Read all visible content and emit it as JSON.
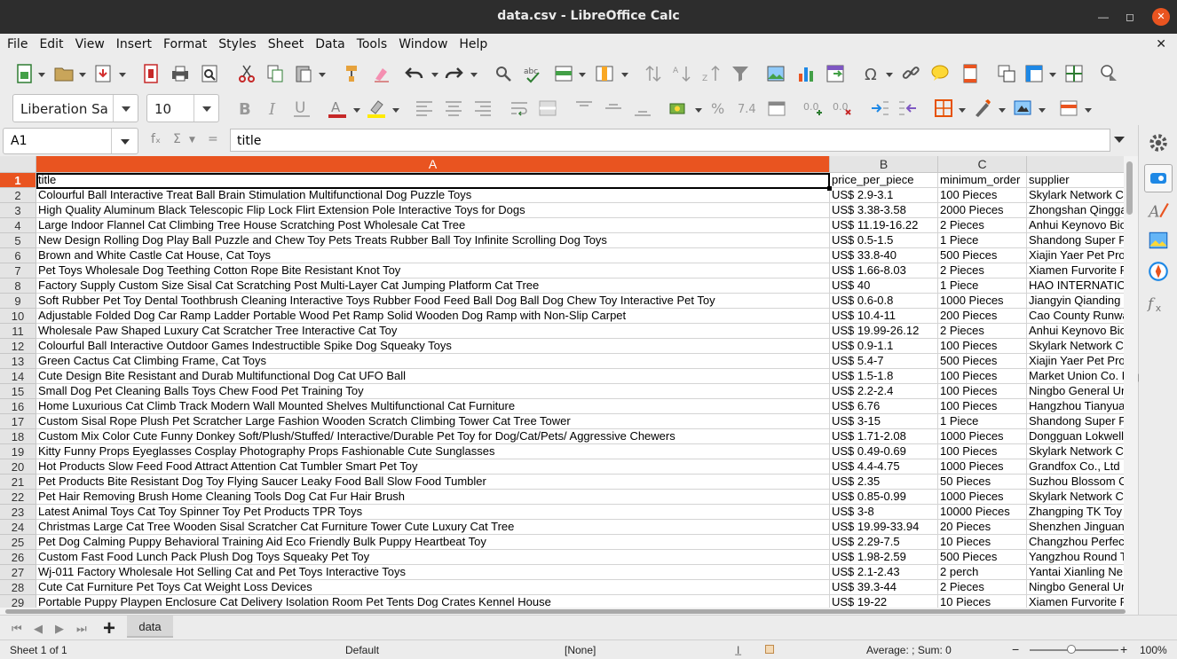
{
  "window": {
    "title": "data.csv - LibreOffice Calc"
  },
  "menu": [
    "File",
    "Edit",
    "View",
    "Insert",
    "Format",
    "Styles",
    "Sheet",
    "Data",
    "Tools",
    "Window",
    "Help"
  ],
  "formatting": {
    "font_name": "Liberation Sa",
    "font_size": "10"
  },
  "formula_bar": {
    "cell_ref": "A1",
    "content": "title"
  },
  "columns": [
    {
      "letter": "A",
      "selected": true
    },
    {
      "letter": "B",
      "selected": false
    },
    {
      "letter": "C",
      "selected": false
    },
    {
      "letter": "",
      "selected": false
    }
  ],
  "rows": [
    {
      "n": "1",
      "cells": [
        "title",
        "price_per_piece",
        "minimum_order",
        "supplier"
      ]
    },
    {
      "n": "2",
      "cells": [
        "Colourful Ball Interactive Treat Ball Brain Stimulation Multifunctional Dog Puzzle Toys",
        "US$ 2.9-3.1",
        "100 Pieces",
        "Skylark Network C"
      ]
    },
    {
      "n": "3",
      "cells": [
        "High Quality Aluminum Black Telescopic Flip Lock Flirt Extension Pole Interactive Toys for Dogs",
        "US$ 3.38-3.58",
        "2000 Pieces",
        "Zhongshan Qingga"
      ]
    },
    {
      "n": "4",
      "cells": [
        "Large Indoor Flannel Cat Climbing Tree House Scratching Post Wholesale Cat Tree",
        "US$ 11.19-16.22",
        "2 Pieces",
        "Anhui Keynovo Bio"
      ]
    },
    {
      "n": "5",
      "cells": [
        "New Design Rolling Dog Play Ball Puzzle and Chew Toy Pets Treats Rubber Ball Toy Infinite Scrolling Dog Toys",
        "US$ 0.5-1.5",
        "1 Piece",
        "Shandong Super P"
      ]
    },
    {
      "n": "6",
      "cells": [
        "Brown and White Castle Cat House, Cat Toys",
        "US$ 33.8-40",
        "500 Pieces",
        "Xiajin Yaer Pet Pro"
      ]
    },
    {
      "n": "7",
      "cells": [
        "Pet Toys Wholesale Dog Teething Cotton Rope Bite Resistant Knot Toy",
        "US$ 1.66-8.03",
        "2 Pieces",
        "Xiamen Furvorite F"
      ]
    },
    {
      "n": "8",
      "cells": [
        "Factory Supply Custom Size Sisal Cat Scratching Post Multi-Layer Cat Jumping Platform Cat Tree",
        "US$ 40",
        "1 Piece",
        "HAO INTERNATIO"
      ]
    },
    {
      "n": "9",
      "cells": [
        "Soft Rubber Pet Toy Dental Toothbrush Cleaning Interactive Toys Rubber Food Feed Ball Dog Ball Dog Chew Toy Interactive Pet Toy",
        "US$ 0.6-0.8",
        "1000 Pieces",
        "Jiangyin Qianding"
      ]
    },
    {
      "n": "10",
      "cells": [
        "Adjustable Folded Dog Car Ramp Ladder Portable Wood Pet Ramp Solid Wooden Dog Ramp with Non-Slip Carpet",
        "US$ 10.4-11",
        "200 Pieces",
        "Cao County Runwa"
      ]
    },
    {
      "n": "11",
      "cells": [
        "Wholesale Paw Shaped Luxury Cat Scratcher Tree Interactive Cat Toy",
        "US$ 19.99-26.12",
        "2 Pieces",
        "Anhui Keynovo Bio"
      ]
    },
    {
      "n": "12",
      "cells": [
        "Colourful Ball Interactive Outdoor Games Indestructible Spike Dog Squeaky Toys",
        "US$ 0.9-1.1",
        "100 Pieces",
        "Skylark Network C"
      ]
    },
    {
      "n": "13",
      "cells": [
        "Green Cactus Cat Climbing Frame, Cat Toys",
        "US$ 5.4-7",
        "500 Pieces",
        "Xiajin Yaer Pet Pro"
      ]
    },
    {
      "n": "14",
      "cells": [
        "Cute Design Bite Resistant and Durab Multifunctional Dog Cat UFO Ball",
        "US$ 1.5-1.8",
        "100 Pieces",
        "Market Union Co. L"
      ]
    },
    {
      "n": "15",
      "cells": [
        "Small Dog Pet Cleaning Balls Toys Chew Food Pet Training Toy",
        "US$ 2.2-2.4",
        "100 Pieces",
        "Ningbo General Un"
      ]
    },
    {
      "n": "16",
      "cells": [
        "Home Luxurious Cat Climb Track Modern Wall Mounted Shelves Multifunctional Cat Furniture",
        "US$ 6.76",
        "100 Pieces",
        "Hangzhou Tianyua"
      ]
    },
    {
      "n": "17",
      "cells": [
        "Custom Sisal Rope Plush Pet Scratcher Large Fashion Wooden Scratch Climbing Tower Cat Tree Tower",
        "US$ 3-15",
        "1 Piece",
        "Shandong Super P"
      ]
    },
    {
      "n": "18",
      "cells": [
        "Custom Mix Color Cute Funny Donkey Soft/Plush/Stuffed/ Interactive/Durable Pet Toy for Dog/Cat/Pets/ Aggressive Chewers",
        "US$ 1.71-2.08",
        "1000 Pieces",
        "Dongguan Lokwell"
      ]
    },
    {
      "n": "19",
      "cells": [
        "Kitty Funny Props Eyeglasses Cosplay Photography Props Fashionable Cute Sunglasses",
        "US$ 0.49-0.69",
        "100 Pieces",
        "Skylark Network C"
      ]
    },
    {
      "n": "20",
      "cells": [
        "Hot Products Slow Feed Food Attract Attention Cat Tumbler Smart Pet Toy",
        "US$ 4.4-4.75",
        "1000 Pieces",
        "Grandfox Co., Ltd"
      ]
    },
    {
      "n": "21",
      "cells": [
        "Pet Products Bite Resistant Dog Toy Flying Saucer Leaky Food Ball Slow Food Tumbler",
        "US$ 2.35",
        "50 Pieces",
        "Suzhou Blossom C"
      ]
    },
    {
      "n": "22",
      "cells": [
        "Pet Hair Removing Brush Home Cleaning Tools Dog Cat Fur Hair Brush",
        "US$ 0.85-0.99",
        "1000 Pieces",
        "Skylark Network C"
      ]
    },
    {
      "n": "23",
      "cells": [
        "Latest Animal Toys Cat Toy Spinner Toy Pet Products TPR Toys",
        "US$ 3-8",
        "10000 Pieces",
        "Zhangping TK Toy"
      ]
    },
    {
      "n": "24",
      "cells": [
        "Christmas Large Cat Tree Wooden Sisal Scratcher Cat Furniture Tower Cute Luxury Cat Tree",
        "US$ 19.99-33.94",
        "20 Pieces",
        "Shenzhen Jinguan"
      ]
    },
    {
      "n": "25",
      "cells": [
        "Pet Dog Calming Puppy Behavioral Training Aid Eco Friendly Bulk Puppy Heartbeat Toy",
        "US$ 2.29-7.5",
        "10 Pieces",
        "Changzhou Perfect"
      ]
    },
    {
      "n": "26",
      "cells": [
        "Custom Fast Food Lunch Pack Plush Dog Toys Squeaky Pet Toy",
        "US$ 1.98-2.59",
        "500 Pieces",
        "Yangzhou Round T"
      ]
    },
    {
      "n": "27",
      "cells": [
        "Wj-011 Factory Wholesale Hot Selling Cat and Pet Toys Interactive Toys",
        "US$ 2.1-2.43",
        "2 perch",
        "Yantai Xianling Ne"
      ]
    },
    {
      "n": "28",
      "cells": [
        "Cute Cat Furniture Pet Toys Cat Weight Loss Devices",
        "US$ 39.3-44",
        "2 Pieces",
        "Ningbo General Un"
      ]
    },
    {
      "n": "29",
      "cells": [
        "Portable Puppy Playpen Enclosure Cat Delivery Isolation Room Pet Tents Dog Crates Kennel House",
        "US$ 19-22",
        "10 Pieces",
        "Xiamen Furvorite F"
      ]
    }
  ],
  "sheet_tabs": [
    "data"
  ],
  "status": {
    "sheet": "Sheet 1 of 1",
    "style": "Default",
    "language": "[None]",
    "summary": "Average: ; Sum: 0",
    "zoom": "100%"
  }
}
